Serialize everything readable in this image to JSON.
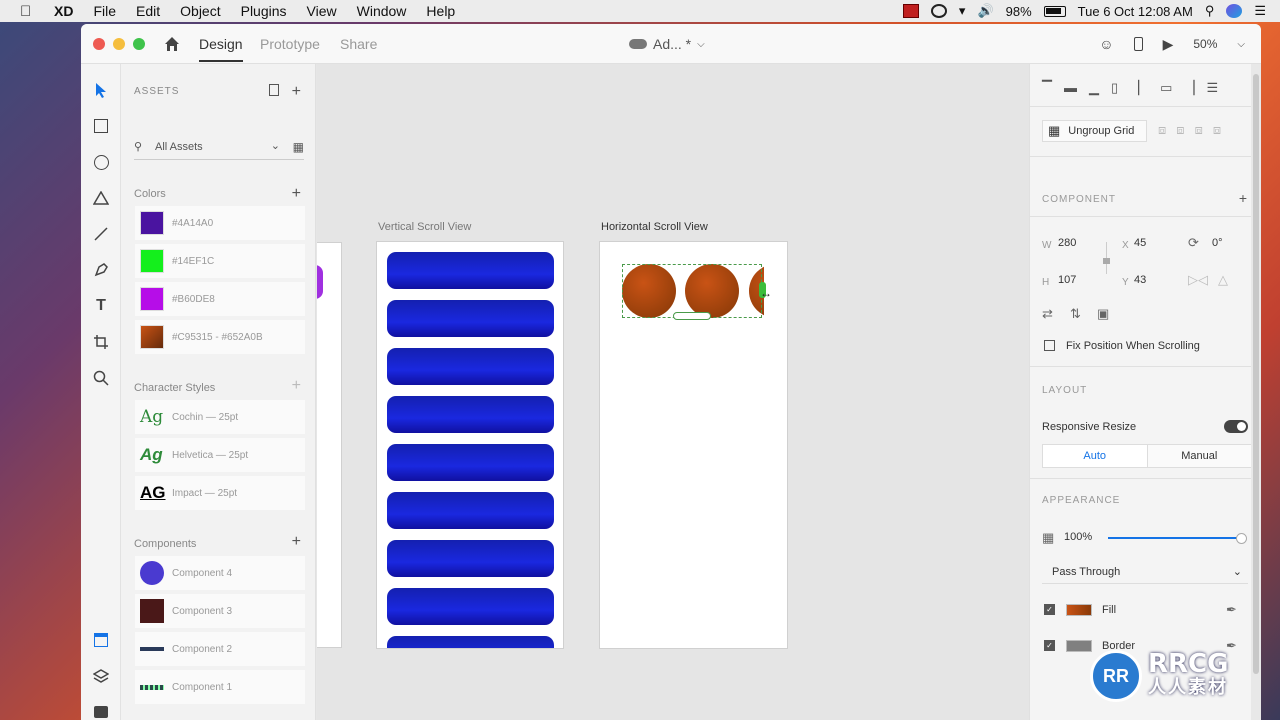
{
  "menubar": {
    "app_name": "XD",
    "items": [
      "File",
      "Edit",
      "Object",
      "Plugins",
      "View",
      "Window",
      "Help"
    ],
    "battery": "98%",
    "clock": "Tue 6 Oct  12:08 AM"
  },
  "titlebar": {
    "tabs": [
      "Design",
      "Prototype",
      "Share"
    ],
    "active_tab": "Design",
    "doc_name": "Ad... *",
    "zoom": "50%"
  },
  "assets": {
    "title": "ASSETS",
    "filter": "All Assets",
    "colors_label": "Colors",
    "colors": [
      {
        "label": "#4A14A0",
        "hex": "#4A14A0"
      },
      {
        "label": "#14EF1C",
        "hex": "#14EF1C"
      },
      {
        "label": "#B60DE8",
        "hex": "#B60DE8"
      },
      {
        "label": "#C95315 - #652A0B",
        "hex": "#C95315"
      }
    ],
    "char_styles_label": "Character Styles",
    "char_styles": [
      {
        "glyph": "Ag",
        "label": "Cochin — 25pt"
      },
      {
        "glyph": "Ag",
        "label": "Helvetica — 25pt"
      },
      {
        "glyph": "AG",
        "label": "Impact — 25pt"
      }
    ],
    "components_label": "Components",
    "components": [
      {
        "label": "Component 4"
      },
      {
        "label": "Component 3"
      },
      {
        "label": "Component 2"
      },
      {
        "label": "Component 1"
      }
    ]
  },
  "canvas": {
    "artboards": [
      "Vertical Scroll View",
      "Horizontal Scroll View"
    ]
  },
  "inspector": {
    "ungroup_grid": "Ungroup Grid",
    "component_title": "COMPONENT",
    "w_label": "W",
    "w": "280",
    "h_label": "H",
    "h": "107",
    "x_label": "X",
    "x": "45",
    "y_label": "Y",
    "y": "43",
    "rotation": "0°",
    "fix_position": "Fix Position When Scrolling",
    "layout_title": "LAYOUT",
    "responsive_resize": "Responsive Resize",
    "seg_auto": "Auto",
    "seg_manual": "Manual",
    "appearance_title": "APPEARANCE",
    "opacity": "100%",
    "blend_mode": "Pass Through",
    "fill_label": "Fill",
    "fill_color": "#C95315",
    "border_label": "Border",
    "border_color": "#808080"
  },
  "watermark": {
    "logo": "RR",
    "text": "RRCG",
    "sub": "人人素材"
  }
}
